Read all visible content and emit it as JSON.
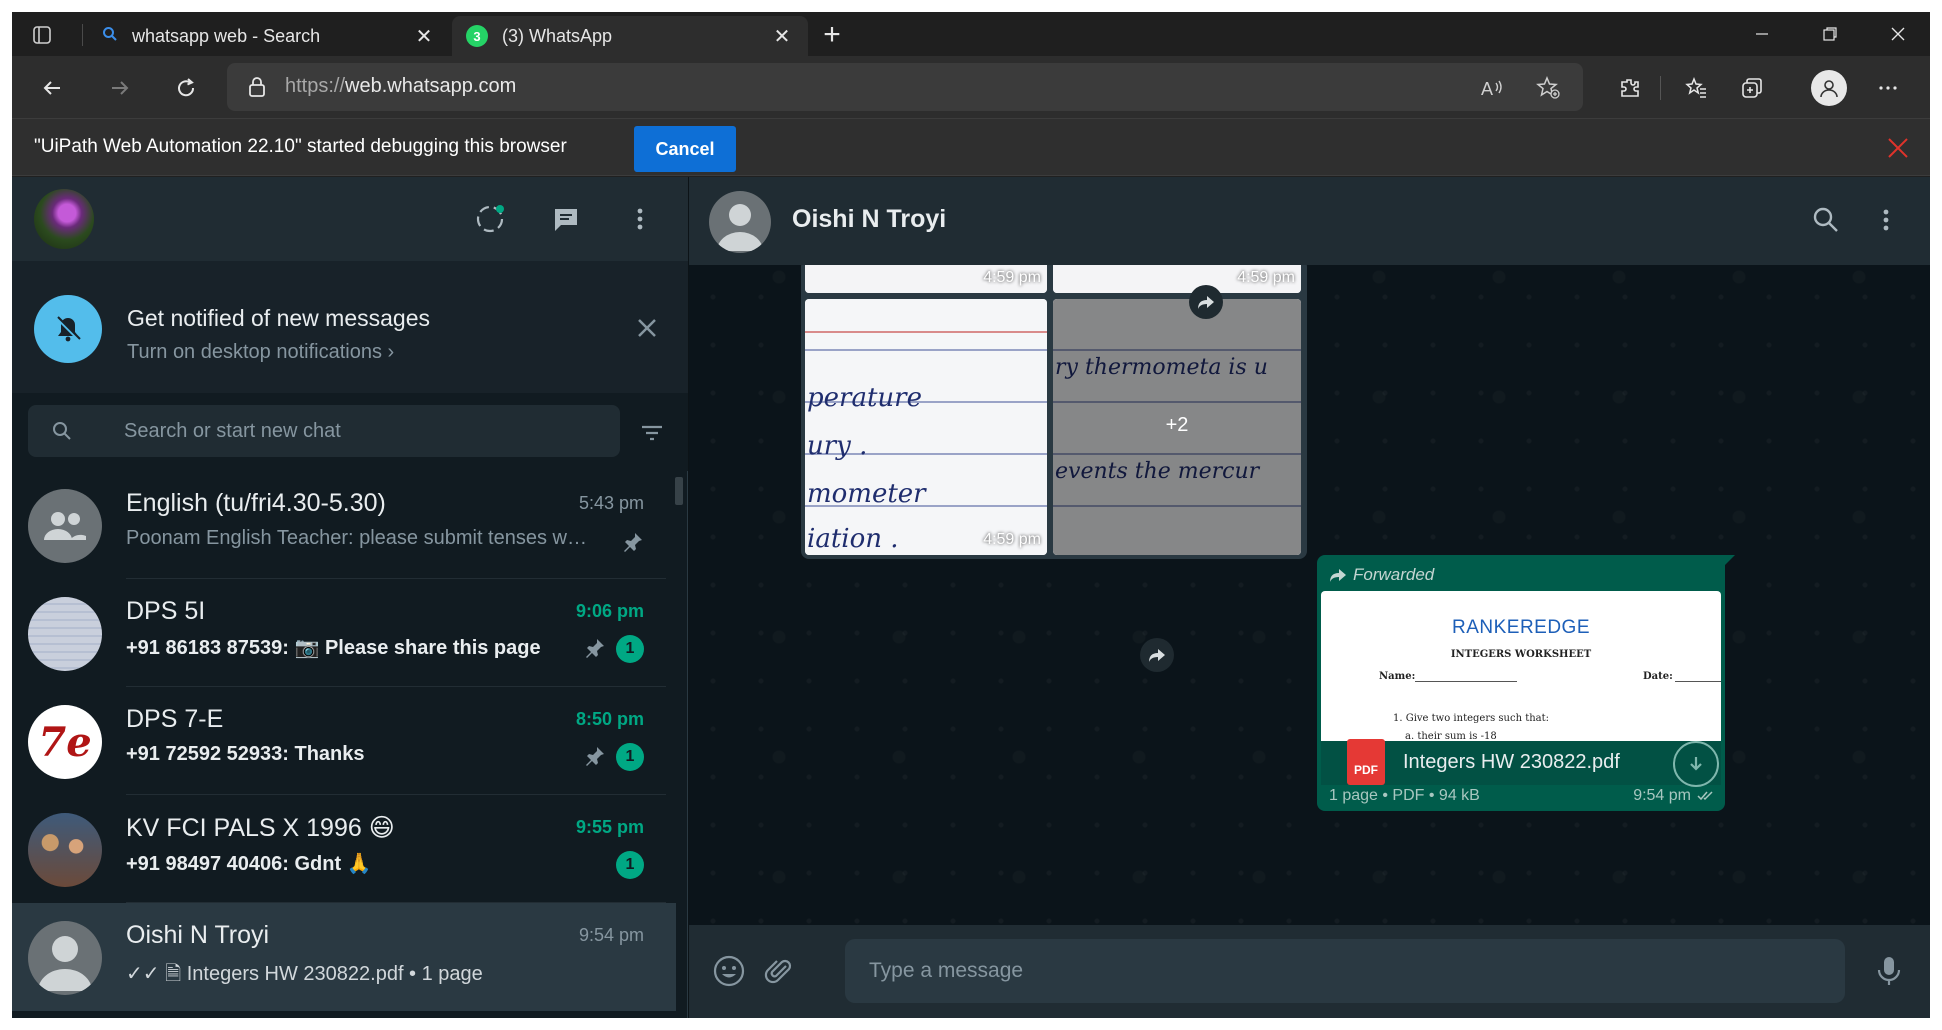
{
  "browser": {
    "tabs": [
      {
        "title": "whatsapp web - Search",
        "icon": "search-icon"
      },
      {
        "title": "(3) WhatsApp",
        "icon": "whatsapp-icon",
        "badge": "3"
      }
    ],
    "url_protocol": "https://",
    "url_host": "web.whatsapp.com",
    "infobar_text": "\"UiPath Web Automation 22.10\" started debugging this browser",
    "infobar_cancel": "Cancel"
  },
  "notification": {
    "title": "Get notified of new messages",
    "subtitle": "Turn on desktop notifications ›"
  },
  "search": {
    "placeholder": "Search or start new chat"
  },
  "chats": [
    {
      "name": "English (tu/fri4.30-5.30)",
      "time": "5:43 pm",
      "last": "Poonam English Teacher: please submit tenses work…",
      "pinned": true,
      "unread": null
    },
    {
      "name": "DPS 5I",
      "time": "9:06 pm",
      "last": "+91 86183 87539: 📷 Please share this page",
      "pinned": true,
      "unread": "1"
    },
    {
      "name": "DPS 7-E",
      "time": "8:50 pm",
      "last": "+91 72592 52933: Thanks",
      "pinned": true,
      "unread": "1",
      "avatar_text": "7e"
    },
    {
      "name": "KV FCI PALS X 1996 😄",
      "time": "9:55 pm",
      "last": "+91 98497 40406: Gdnt 🙏",
      "pinned": false,
      "unread": "1"
    },
    {
      "name": "Oishi N Troyi",
      "time": "9:54 pm",
      "last": "✓✓ 🗎 Integers HW 230822.pdf • 1 page",
      "pinned": false,
      "unread": null
    }
  ],
  "conversation": {
    "name": "Oishi N Troyi",
    "photos": {
      "time_top_left": "4:59 pm",
      "time_top_right": "4:59 pm",
      "time_bottom_left": "4:59 pm",
      "more_count": "+2",
      "handwriting_left": [
        "perature",
        "ury .",
        "mometer",
        "iation ."
      ],
      "handwriting_right": [
        "ry thermometa is u",
        "events the mercur"
      ]
    },
    "document": {
      "forwarded_label": "Forwarded",
      "brand": "RANKEREDGE",
      "worksheet_title": "INTEGERS WORKSHEET",
      "name_field": "Name:",
      "date_field": "Date:",
      "q1": "1.  Give two integers such that:",
      "q1a": "a.  their sum is -18",
      "file_name": "Integers HW 230822.pdf",
      "pdf_label": "PDF",
      "meta": "1 page • PDF • 94 kB",
      "time": "9:54 pm"
    },
    "compose_placeholder": "Type a message"
  },
  "colors": {
    "wa_green": "#00a884",
    "bubble_out": "#005c4b",
    "panel": "#202c33",
    "background": "#111b21",
    "notif_blue": "#53bdeb",
    "cancel_blue": "#0e6fd6",
    "close_red": "#e0332b"
  }
}
